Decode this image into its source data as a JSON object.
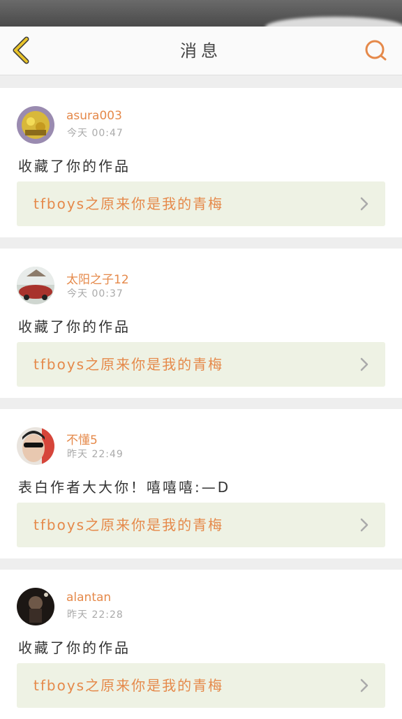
{
  "header": {
    "title": "消息",
    "back_icon": "chevron-left-icon",
    "search_icon": "search-icon"
  },
  "colors": {
    "accent": "#e5894a",
    "back_icon": "#e8c32a",
    "link_bg": "#eef2e4"
  },
  "messages": [
    {
      "username": "asura003",
      "time": "今天 00:47",
      "text": "收藏了你的作品",
      "work_title": "tfboys之原来你是我的青梅"
    },
    {
      "username": "太阳之子12",
      "time": "今天 00:37",
      "text": "收藏了你的作品",
      "work_title": "tfboys之原来你是我的青梅"
    },
    {
      "username": "不懂5",
      "time": "昨天 22:49",
      "text": "表白作者大大你！嘻嘻嘻:—D",
      "work_title": "tfboys之原来你是我的青梅"
    },
    {
      "username": "alantan",
      "time": "昨天 22:28",
      "text": "收藏了你的作品",
      "work_title": "tfboys之原来你是我的青梅"
    }
  ]
}
